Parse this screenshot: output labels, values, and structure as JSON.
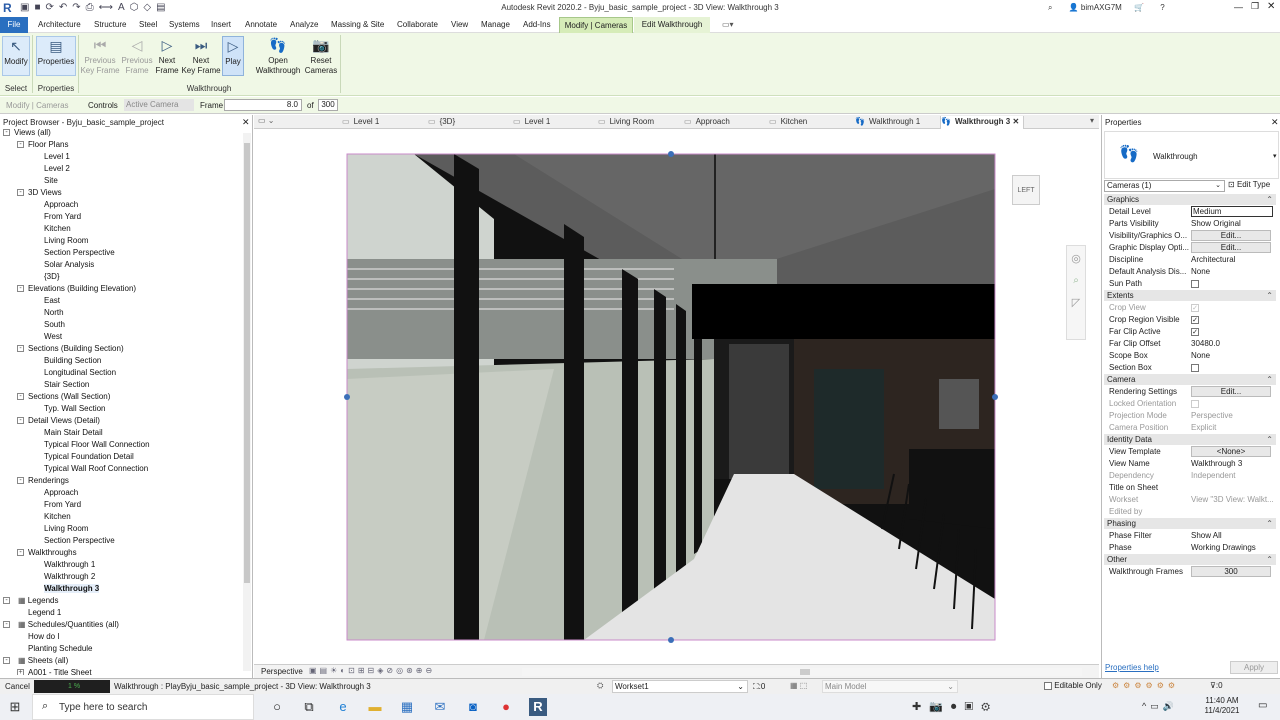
{
  "app": {
    "title": "Autodesk Revit 2020.2 - Byju_basic_sample_project - 3D View: Walkthrough 3",
    "user": "bimAXG7M"
  },
  "menu": [
    "File",
    "Architecture",
    "Structure",
    "Steel",
    "Systems",
    "Insert",
    "Annotate",
    "Analyze",
    "Massing & Site",
    "Collaborate",
    "View",
    "Manage",
    "Add-Ins",
    "Modify | Cameras",
    "Edit Walkthrough"
  ],
  "ribbon": {
    "modify": "Modify",
    "properties": "Properties",
    "prev_key_1": "Previous",
    "prev_key_2": "Key Frame",
    "prev_frame_1": "Previous",
    "prev_frame_2": "Frame",
    "next_frame_1": "Next",
    "next_frame_2": "Frame",
    "next_key_1": "Next",
    "next_key_2": "Key Frame",
    "play": "Play",
    "open_1": "Open",
    "open_2": "Walkthrough",
    "reset_1": "Reset",
    "reset_2": "Cameras",
    "panel_select": "Select",
    "panel_properties": "Properties",
    "panel_walkthrough": "Walkthrough"
  },
  "options": {
    "context": "Modify | Cameras",
    "controls_label": "Controls",
    "controls_value": "Active Camera",
    "frame_label": "Frame",
    "frame_value": "8.0",
    "of_label": "of",
    "total": "300"
  },
  "browser": {
    "title": "Project Browser - Byju_basic_sample_project"
  },
  "tree": [
    {
      "label": "Views (all)",
      "lv": 0,
      "t": "-"
    },
    {
      "label": "Floor Plans",
      "lv": 1,
      "t": "-"
    },
    {
      "label": "Level 1",
      "lv": 2
    },
    {
      "label": "Level 2",
      "lv": 2
    },
    {
      "label": "Site",
      "lv": 2
    },
    {
      "label": "3D Views",
      "lv": 1,
      "t": "-"
    },
    {
      "label": "Approach",
      "lv": 2
    },
    {
      "label": "From Yard",
      "lv": 2
    },
    {
      "label": "Kitchen",
      "lv": 2
    },
    {
      "label": "Living Room",
      "lv": 2
    },
    {
      "label": "Section Perspective",
      "lv": 2
    },
    {
      "label": "Solar Analysis",
      "lv": 2
    },
    {
      "label": "{3D}",
      "lv": 2
    },
    {
      "label": "Elevations (Building Elevation)",
      "lv": 1,
      "t": "-"
    },
    {
      "label": "East",
      "lv": 2
    },
    {
      "label": "North",
      "lv": 2
    },
    {
      "label": "South",
      "lv": 2
    },
    {
      "label": "West",
      "lv": 2
    },
    {
      "label": "Sections (Building Section)",
      "lv": 1,
      "t": "-"
    },
    {
      "label": "Building Section",
      "lv": 2
    },
    {
      "label": "Longitudinal Section",
      "lv": 2
    },
    {
      "label": "Stair Section",
      "lv": 2
    },
    {
      "label": "Sections (Wall Section)",
      "lv": 1,
      "t": "-"
    },
    {
      "label": "Typ. Wall Section",
      "lv": 2
    },
    {
      "label": "Detail Views (Detail)",
      "lv": 1,
      "t": "-"
    },
    {
      "label": "Main Stair Detail",
      "lv": 2
    },
    {
      "label": "Typical Floor Wall Connection",
      "lv": 2
    },
    {
      "label": "Typical Foundation Detail",
      "lv": 2
    },
    {
      "label": "Typical Wall Roof Connection",
      "lv": 2
    },
    {
      "label": "Renderings",
      "lv": 1,
      "t": "-"
    },
    {
      "label": "Approach",
      "lv": 2
    },
    {
      "label": "From Yard",
      "lv": 2
    },
    {
      "label": "Kitchen",
      "lv": 2
    },
    {
      "label": "Living Room",
      "lv": 2
    },
    {
      "label": "Section Perspective",
      "lv": 2
    },
    {
      "label": "Walkthroughs",
      "lv": 1,
      "t": "-"
    },
    {
      "label": "Walkthrough 1",
      "lv": 2
    },
    {
      "label": "Walkthrough 2",
      "lv": 2
    },
    {
      "label": "Walkthrough 3",
      "lv": 2,
      "sel": true
    },
    {
      "label": "Legends",
      "lv": 0,
      "t": "-",
      "ic": true
    },
    {
      "label": "Legend 1",
      "lv": 1
    },
    {
      "label": "Schedules/Quantities (all)",
      "lv": 0,
      "t": "-",
      "ic": true
    },
    {
      "label": "How do I",
      "lv": 1
    },
    {
      "label": "Planting Schedule",
      "lv": 1
    },
    {
      "label": "Sheets (all)",
      "lv": 0,
      "t": "-",
      "ic": true
    },
    {
      "label": "A001 - Title Sheet",
      "lv": 1,
      "t": "+"
    }
  ],
  "tabs": [
    {
      "label": "Level 1"
    },
    {
      "label": "{3D}"
    },
    {
      "label": "Level 1"
    },
    {
      "label": "Living Room"
    },
    {
      "label": "Approach"
    },
    {
      "label": "Kitchen"
    },
    {
      "label": "Walkthrough 1"
    },
    {
      "label": "Walkthrough 3",
      "active": true
    }
  ],
  "viewcube": {
    "face": "LEFT"
  },
  "viewctl": {
    "label": "Perspective"
  },
  "props": {
    "title": "Properties",
    "type": "Walkthrough",
    "selector": "Cameras (1)",
    "edit_type": "Edit Type",
    "help": "Properties help",
    "apply": "Apply",
    "rows": [
      {
        "g": "Graphics"
      },
      {
        "k": "Detail Level",
        "v": "Medium",
        "box": true
      },
      {
        "k": "Parts Visibility",
        "v": "Show Original"
      },
      {
        "k": "Visibility/Graphics O...",
        "v": "Edit...",
        "b": true
      },
      {
        "k": "Graphic Display Opti...",
        "v": "Edit...",
        "b": true
      },
      {
        "k": "Discipline",
        "v": "Architectural"
      },
      {
        "k": "Default Analysis Dis...",
        "v": "None"
      },
      {
        "k": "Sun Path",
        "cb": false
      },
      {
        "g": "Extents"
      },
      {
        "k": "Crop View",
        "cb": true,
        "gray": true
      },
      {
        "k": "Crop Region Visible",
        "cb": true
      },
      {
        "k": "Far Clip Active",
        "cb": true
      },
      {
        "k": "Far Clip Offset",
        "v": "30480.0"
      },
      {
        "k": "Scope Box",
        "v": "None"
      },
      {
        "k": "Section Box",
        "cb": false
      },
      {
        "g": "Camera"
      },
      {
        "k": "Rendering Settings",
        "v": "Edit...",
        "b": true
      },
      {
        "k": "Locked Orientation",
        "cb": false,
        "gray": true
      },
      {
        "k": "Projection Mode",
        "v": "Perspective",
        "gray": true
      },
      {
        "k": "Camera Position",
        "v": "Explicit",
        "gray": true
      },
      {
        "g": "Identity Data"
      },
      {
        "k": "View Template",
        "v": "<None>",
        "b": true
      },
      {
        "k": "View Name",
        "v": "Walkthrough 3"
      },
      {
        "k": "Dependency",
        "v": "Independent",
        "gray": true
      },
      {
        "k": "Title on Sheet",
        "v": ""
      },
      {
        "k": "Workset",
        "v": "View \"3D View: Walkt...",
        "gray": true
      },
      {
        "k": "Edited by",
        "v": "",
        "gray": true
      },
      {
        "g": "Phasing"
      },
      {
        "k": "Phase Filter",
        "v": "Show All"
      },
      {
        "k": "Phase",
        "v": "Working Drawings"
      },
      {
        "g": "Other"
      },
      {
        "k": "Walkthrough Frames",
        "v": "300",
        "b": true
      }
    ]
  },
  "status": {
    "cancel": "Cancel",
    "progress": "1 %",
    "message": "Walkthrough : PlayByju_basic_sample_project - 3D View: Walkthrough 3",
    "workset": "Workset1",
    "zero": ":0",
    "model": "Main Model",
    "editable": "Editable Only",
    "filter": ":0"
  },
  "taskbar": {
    "search": "Type here to search",
    "time": "11:40 AM",
    "date": "11/4/2021"
  },
  "colors": {
    "ribbon_bg": "#f0f8e6",
    "contextual_tab": "#d6ecb8",
    "accent": "#2a6fc0"
  }
}
